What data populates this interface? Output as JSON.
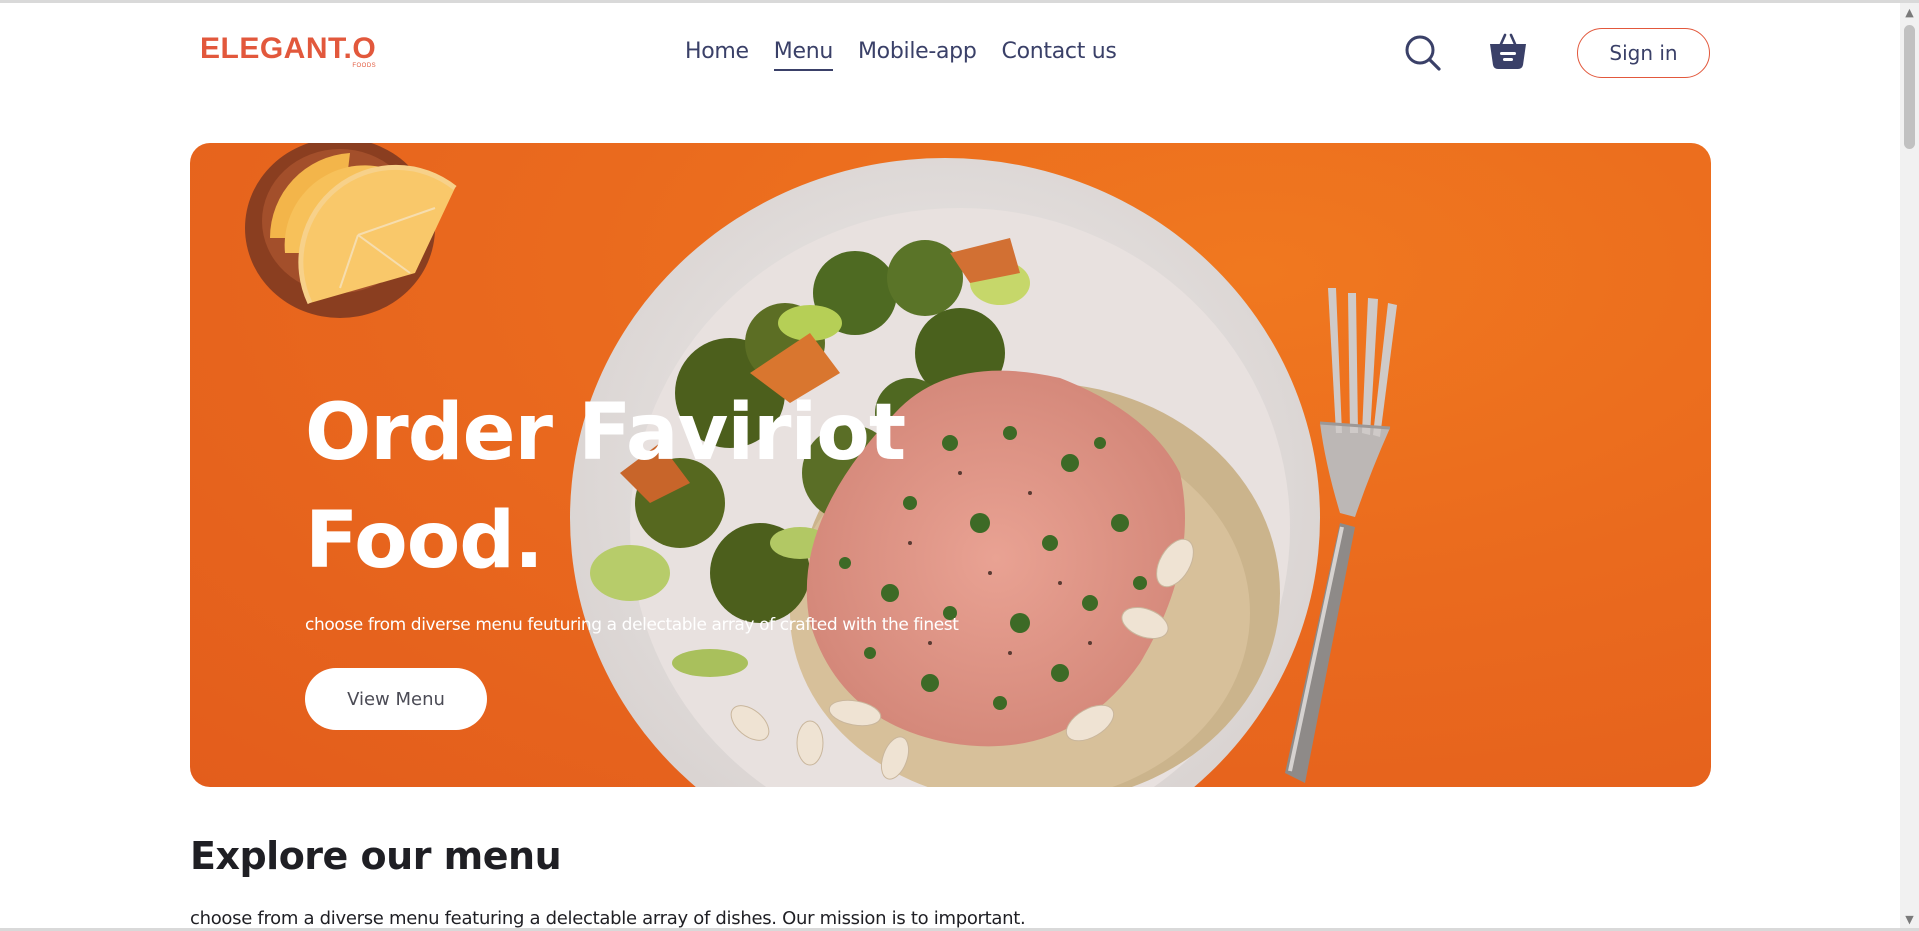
{
  "header": {
    "logo": {
      "main": "ELEGANT.O",
      "sub": "FOODS"
    },
    "nav": [
      {
        "label": "Home",
        "active": false
      },
      {
        "label": "Menu",
        "active": true
      },
      {
        "label": "Mobile-app",
        "active": false
      },
      {
        "label": "Contact us",
        "active": false
      }
    ],
    "search_icon": "search-icon",
    "basket_icon": "basket-icon",
    "signin_label": "Sign in"
  },
  "hero": {
    "title_line1": "Order Faviriot",
    "title_line2": "Food.",
    "subtitle": "choose from diverse menu feuturing a delectable array of crafted with the finest",
    "button_label": "View Menu"
  },
  "explore": {
    "title": "Explore our menu",
    "text": "choose from a diverse menu featuring a delectable array of dishes. Our mission is to important."
  },
  "colors": {
    "accent": "#e2583c",
    "nav_text": "#3a4068",
    "hero_bg": "#ea6a1e"
  }
}
